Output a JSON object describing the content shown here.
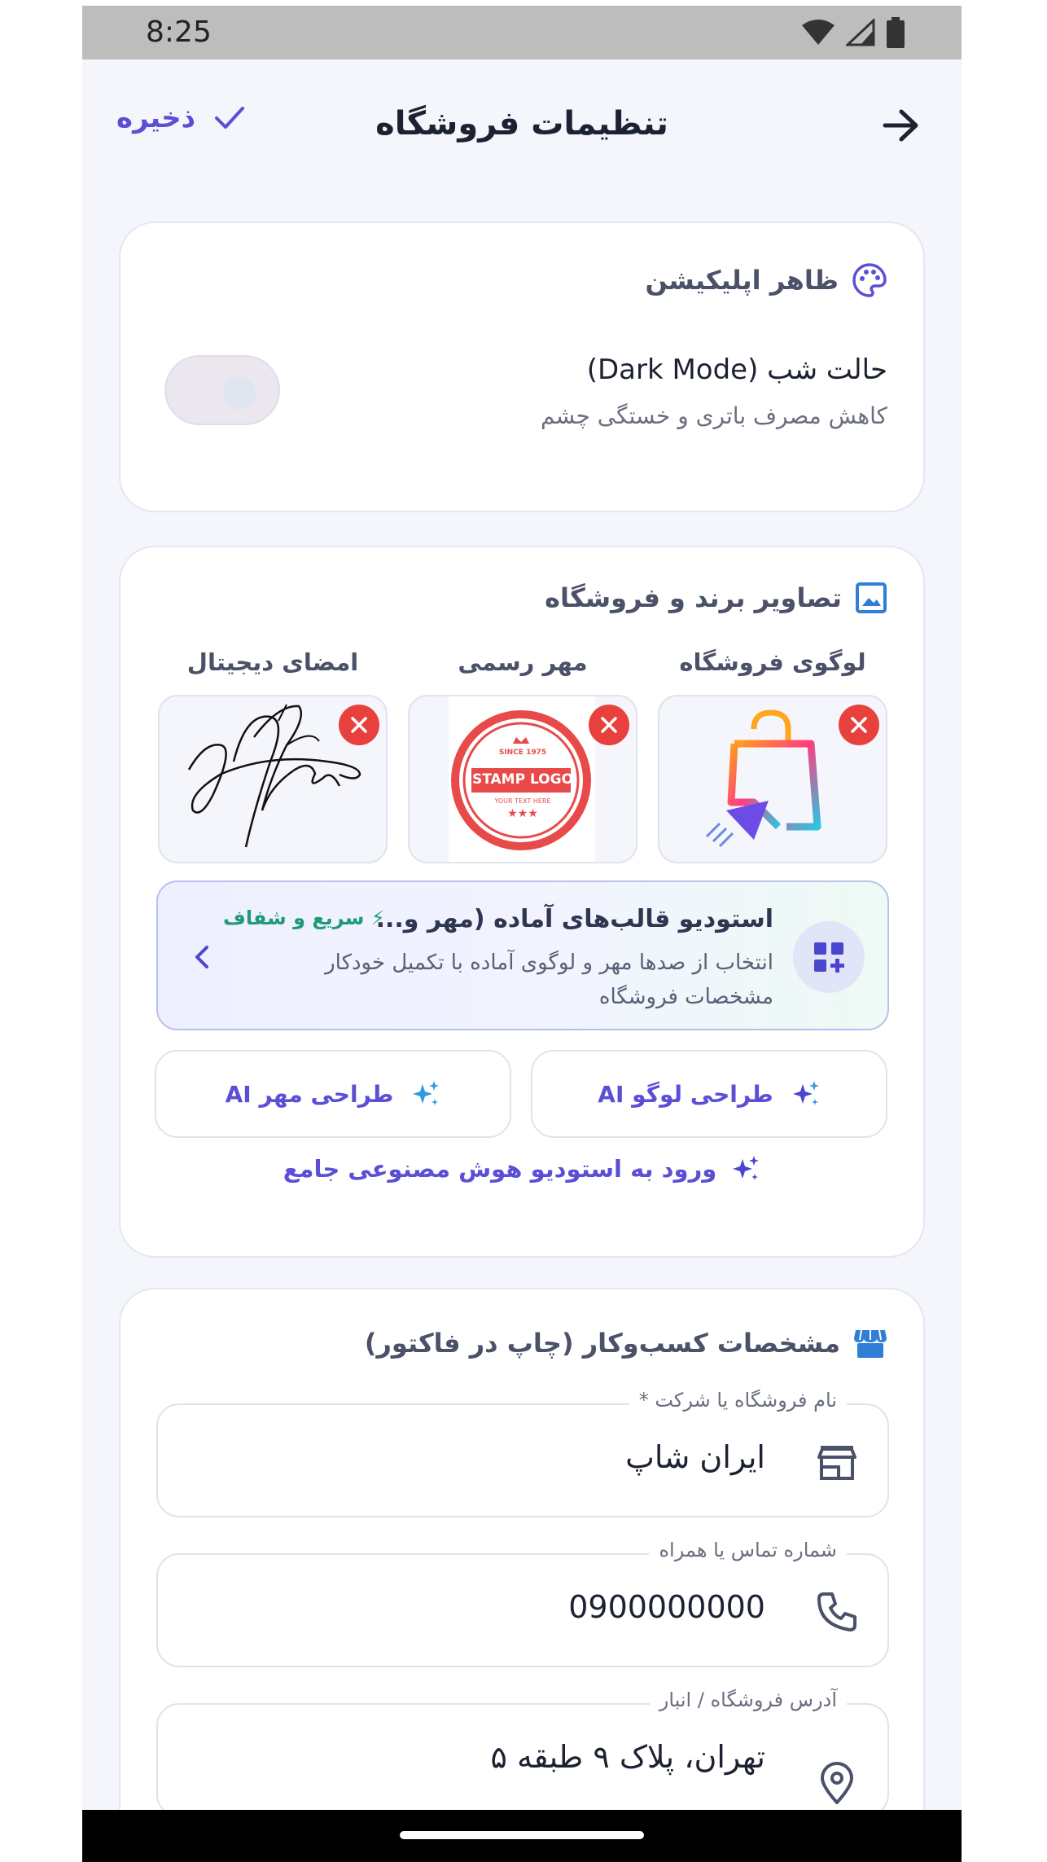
{
  "status_bar": {
    "time": "8:25",
    "icons": [
      "wifi-icon",
      "signal-icon",
      "battery-icon"
    ]
  },
  "header": {
    "title": "تنظیمات فروشگاه",
    "save_label": "ذخیره",
    "back_icon": "arrow-right-icon"
  },
  "appearance": {
    "title": "ظاهر اپلیکیشن",
    "dark_mode_label": "حالت شب (Dark Mode)",
    "dark_mode_desc": "کاهش مصرف باتری و خستگی چشم",
    "dark_mode_enabled": false
  },
  "brand": {
    "title": "تصاویر برند و فروشگاه",
    "images": [
      {
        "label": "لوگوی فروشگاه",
        "icon": "shopping-bag-logo"
      },
      {
        "label": "مهر رسمی",
        "stamp_texts": [
          "SINCE 1975",
          "STAMP LOGO",
          "YOUR TEXT HERE"
        ]
      },
      {
        "label": "امضای دیجیتال",
        "icon": "signature-image"
      }
    ],
    "studio": {
      "title": "استودیو قالب‌های آماده (مهر و...",
      "badge": "⚡ سریع و شفاف",
      "desc": "انتخاب از صدها مهر و لوگوی آماده با تکمیل خودکار مشخصات فروشگاه"
    },
    "ai_logo_label": "طراحی لوگو AI",
    "ai_stamp_label": "طراحی مهر AI",
    "ai_studio_link": "ورود به استودیو هوش مصنوعی جامع"
  },
  "business": {
    "title": "مشخصات کسب‌وکار (چاپ در فاکتور)",
    "fields": [
      {
        "label": "نام فروشگاه یا شرکت *",
        "value": "ایران شاپ",
        "icon": "store-icon"
      },
      {
        "label": "شماره تماس یا همراه",
        "value": "0900000000",
        "icon": "phone-icon"
      },
      {
        "label": "آدرس فروشگاه / انبار",
        "value": "تهران، پلاک ۹ طبقه ۵",
        "icon": "location-icon"
      }
    ]
  },
  "colors": {
    "accent": "#5b4fd6",
    "danger": "#e8413d",
    "success": "#1e9b74"
  }
}
